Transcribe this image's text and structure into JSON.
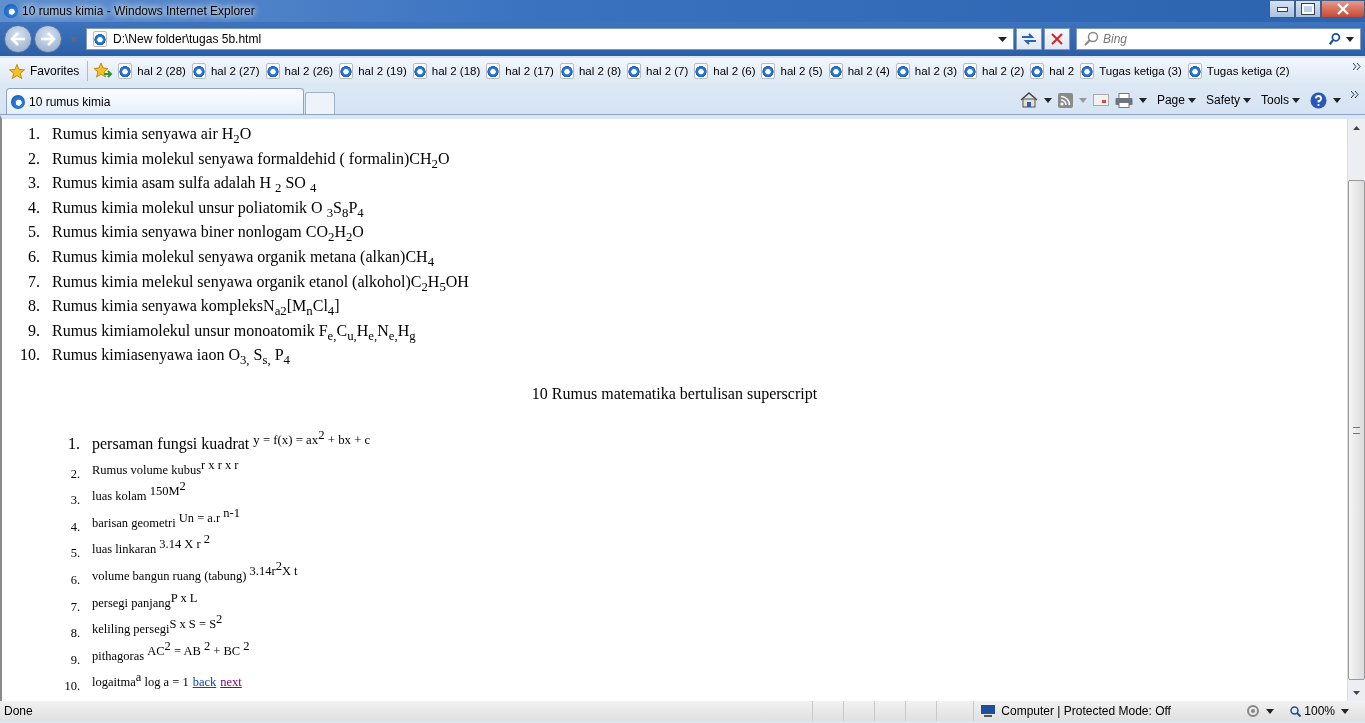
{
  "window": {
    "title": "10 rumus kimia - Windows Internet Explorer"
  },
  "address_bar": {
    "value": "D:\\New folder\\tugas 5b.html"
  },
  "search": {
    "placeholder": "Bing"
  },
  "favorites_bar": {
    "label": "Favorites",
    "items": [
      {
        "label": "hal 2 (28)"
      },
      {
        "label": "hal 2 (27)"
      },
      {
        "label": "hal 2 (26)"
      },
      {
        "label": "hal 2 (19)"
      },
      {
        "label": "hal 2 (18)"
      },
      {
        "label": "hal 2 (17)"
      },
      {
        "label": "hal 2 (8)"
      },
      {
        "label": "hal 2 (7)"
      },
      {
        "label": "hal 2 (6)"
      },
      {
        "label": "hal 2 (5)"
      },
      {
        "label": "hal 2 (4)"
      },
      {
        "label": "hal 2 (3)"
      },
      {
        "label": "hal 2 (2)"
      },
      {
        "label": "hal 2"
      },
      {
        "label": "Tugas ketiga (3)"
      },
      {
        "label": "Tugas ketiga (2)"
      }
    ]
  },
  "tabs": [
    {
      "label": "10 rumus kimia",
      "selected": true
    }
  ],
  "command_bar": [
    "Page",
    "Safety",
    "Tools"
  ],
  "chemistry_list": [
    {
      "marker": "1.",
      "text": "Rumus kimia senyawa air H$_{2}$O"
    },
    {
      "marker": "2.",
      "text": "Rumus kimia molekul senyawa formaldehid ( formalin)CH$_{2}$O"
    },
    {
      "marker": "3.",
      "text": "Rumus kimia asam sulfa adalah H $_{2}$ SO $_{4}$"
    },
    {
      "marker": "4.",
      "text": "Rumus kimia molekul unsur poliatomik O $_{3}$S$_{8}$P$_{4}$"
    },
    {
      "marker": "5.",
      "text": "Rumus kimia senyawa biner nonlogam CO$_{2}$H$_{2}$O"
    },
    {
      "marker": "6.",
      "text": "Rumus kimia molekul senyawa organik metana (alkan)CH$_{4}$"
    },
    {
      "marker": "7.",
      "text": "Rumus kimia melekul senyawa organik etanol (alkohol)C$_{2}$H$_{5}$OH"
    },
    {
      "marker": "8.",
      "text": "Rumus kimia senyawa kompleksN$_{a2}$[M$_{n}$Cl$_{4}$]"
    },
    {
      "marker": "9.",
      "text": "Rumus kimiamolekul unsur monoatomik F$_{e,}$C$_{u,}$H$_{e,}$N$_{e,}$H$_{g}$"
    },
    {
      "marker": "10.",
      "text": "Rumus kimiasenyawa iaon O$_{3,}$ S$_{s,}$ P$_{4}$"
    }
  ],
  "math_heading": "10 Rumus matematika bertulisan superscript",
  "math_list": [
    {
      "marker": "1.",
      "text": "persaman fungsi kuadrat $^{y = f(x) = ax}$$^{2}$$^{ + bx + c}$",
      "large": true
    },
    {
      "marker": "2.",
      "text": "Rumus volume kubus$^{r x r x r}$",
      "large": false
    },
    {
      "marker": "3.",
      "text": "luas kolam $^{150M}$$^{2}$",
      "large": false
    },
    {
      "marker": "4.",
      "text": "barisan geometri $^{Un = a.r }$$^{n-1}$",
      "large": false
    },
    {
      "marker": "5.",
      "text": "luas linkaran $^{3.14 X r }$$^{2}$",
      "large": false
    },
    {
      "marker": "6.",
      "text": "volume bangun ruang (tabung) $^{3.14r}$$^{2}$$^{X t}$",
      "large": false
    },
    {
      "marker": "7.",
      "text": "persegi panjang$^{P x L}$",
      "large": false
    },
    {
      "marker": "8.",
      "text": "keliling persegi$^{S x S = S}$$^{2}$",
      "large": false
    },
    {
      "marker": "9.",
      "text": "pithagoras $^{AC}$$^{2}$$^{ = AB }$$^{2}$$^{ + BC }$$^{2}$",
      "large": false
    },
    {
      "marker": "10.",
      "text": "logaitma$^{a}$ log a = 1",
      "large": false,
      "links": [
        {
          "label": "back",
          "visited": false
        },
        {
          "label": "next",
          "visited": true
        }
      ]
    }
  ],
  "status_bar": {
    "status": "Done",
    "zone": "Computer | Protected Mode: Off",
    "zoom": "100%"
  }
}
